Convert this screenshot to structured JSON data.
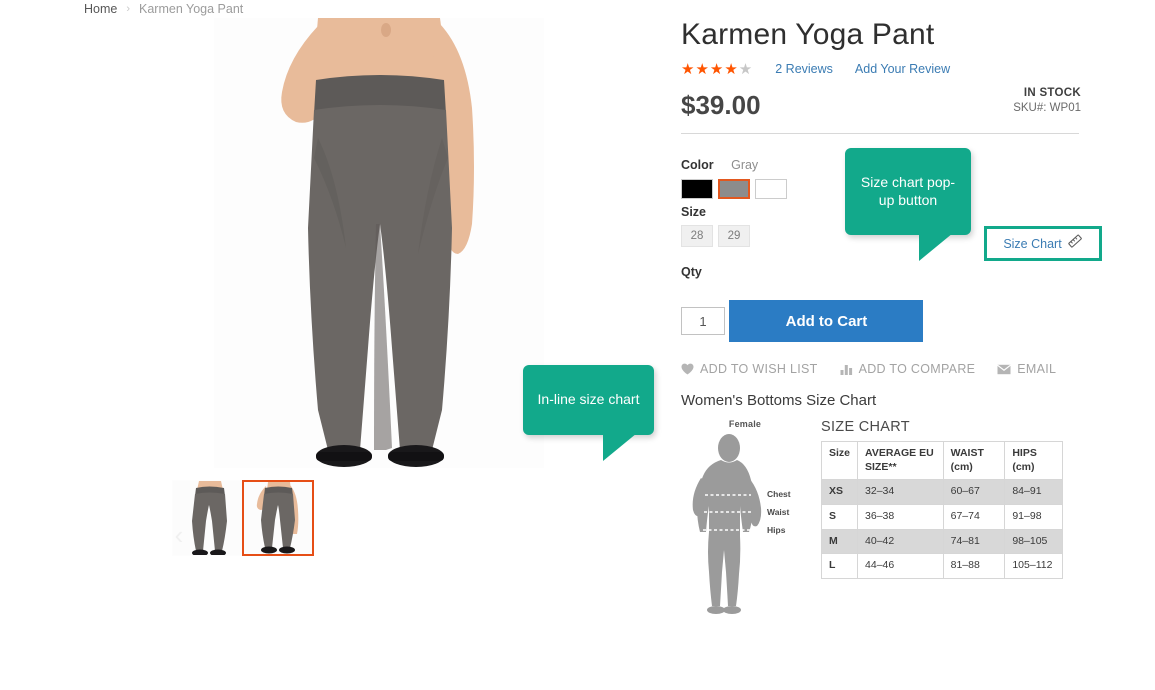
{
  "breadcrumb": {
    "home": "Home",
    "separator": "›",
    "current": "Karmen Yoga Pant"
  },
  "product": {
    "title": "Karmen Yoga Pant",
    "rating_filled": 4,
    "rating_total": 5,
    "reviews_link": "2 Reviews",
    "add_review_link": "Add Your Review",
    "price": "$39.00",
    "stock_status": "IN STOCK",
    "sku_label": "SKU#:",
    "sku_value": "WP01"
  },
  "options": {
    "color_label": "Color",
    "color_value": "Gray",
    "swatches": [
      {
        "name": "black",
        "hex": "#000000",
        "selected": false
      },
      {
        "name": "gray",
        "hex": "#8c8c8c",
        "selected": true
      },
      {
        "name": "white",
        "hex": "#ffffff",
        "selected": false
      }
    ],
    "size_label": "Size",
    "sizes": [
      "28",
      "29"
    ],
    "qty_label": "Qty",
    "qty_value": "1"
  },
  "actions": {
    "add_to_cart": "Add to Cart",
    "wish_list": "ADD TO WISH LIST",
    "compare": "ADD TO COMPARE",
    "email": "EMAIL"
  },
  "size_chart_button": {
    "label": "Size Chart",
    "icon": "ruler-icon"
  },
  "size_chart_section": {
    "heading": "Women's Bottoms Size Chart",
    "figure_title": "Female",
    "figure_labels": [
      "Chest",
      "Waist",
      "Hips"
    ],
    "table_title": "SIZE CHART",
    "columns": [
      "Size",
      "AVERAGE EU SIZE**",
      "WAIST (cm)",
      "HIPS (cm)"
    ],
    "rows": [
      {
        "size": "XS",
        "eu": "32–34",
        "waist": "60–67",
        "hips": "84–91"
      },
      {
        "size": "S",
        "eu": "36–38",
        "waist": "67–74",
        "hips": "91–98"
      },
      {
        "size": "M",
        "eu": "40–42",
        "waist": "74–81",
        "hips": "98–105"
      },
      {
        "size": "L",
        "eu": "44–46",
        "waist": "81–88",
        "hips": "105–112"
      }
    ]
  },
  "callouts": {
    "popup_button": "Size chart pop-up button",
    "inline_chart": "In-line size chart"
  },
  "gallery": {
    "prev_icon": "chevron-left-icon",
    "next_icon": "chevron-right-icon",
    "thumbnails": [
      {
        "name": "thumbnail-1",
        "selected": false
      },
      {
        "name": "thumbnail-2",
        "selected": true
      }
    ]
  },
  "colors": {
    "accent_teal": "#12a98b",
    "cart_blue": "#2b7cc4",
    "star_orange": "#ff5501",
    "swatch_selected": "#e2581f"
  }
}
